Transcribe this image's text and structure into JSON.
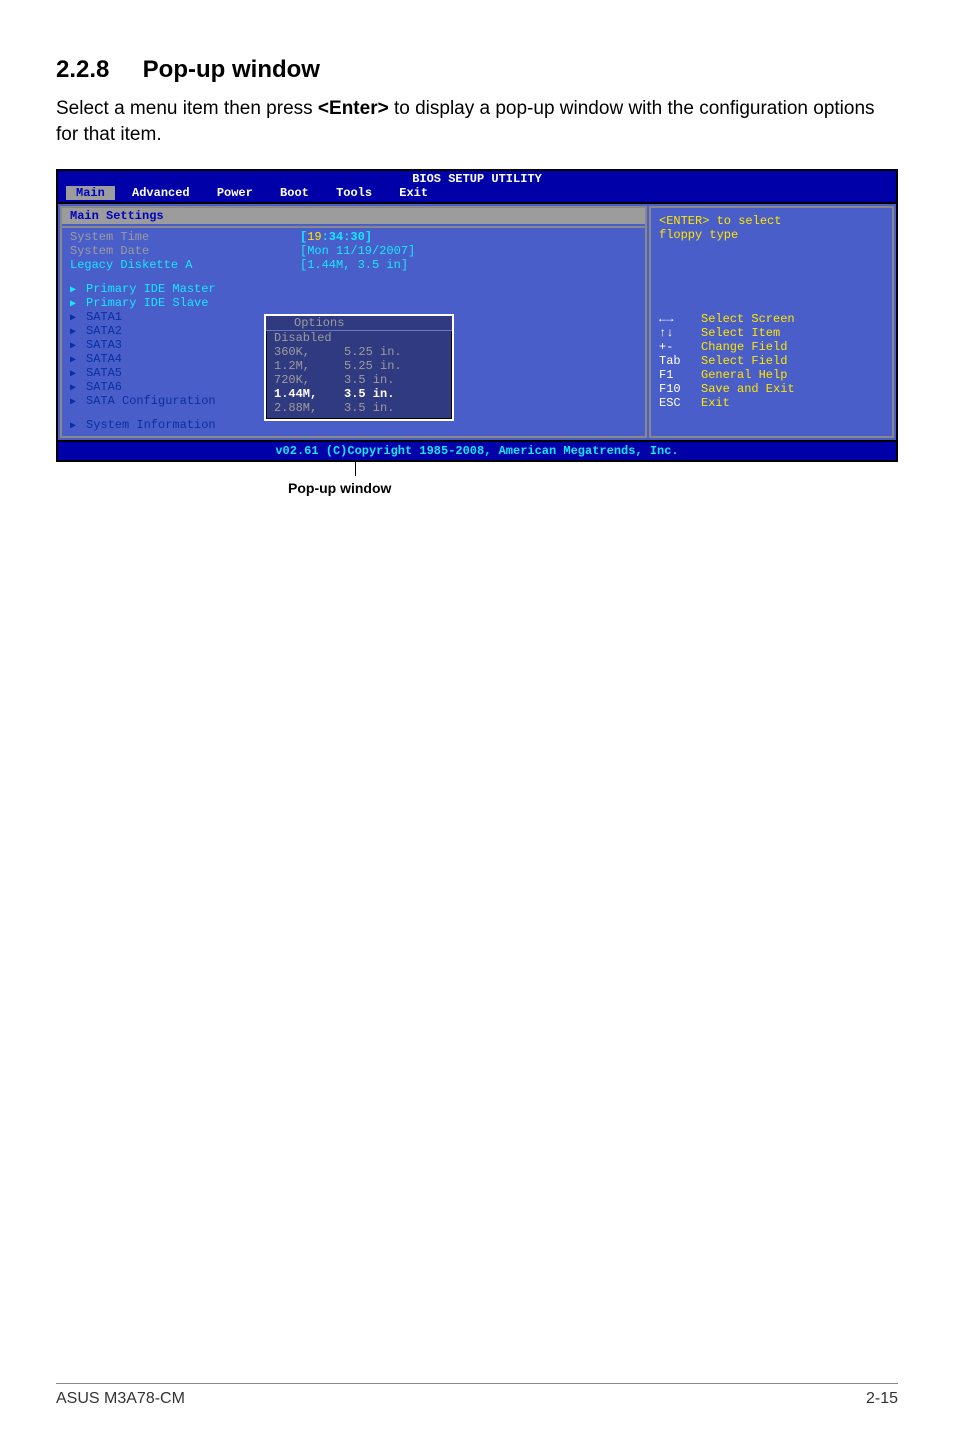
{
  "heading_num": "2.2.8",
  "heading_text": "Pop-up window",
  "intro_pre": "Select a menu item then press ",
  "intro_bold": "<Enter>",
  "intro_post": " to display a pop-up window with the configuration options for that item.",
  "bios": {
    "title": "BIOS SETUP UTILITY",
    "menu": {
      "items": [
        {
          "label": "Main",
          "active": true
        },
        {
          "label": "Advanced"
        },
        {
          "label": "Power"
        },
        {
          "label": "Boot"
        },
        {
          "label": "Tools"
        },
        {
          "label": "Exit"
        }
      ]
    },
    "section": "Main Settings",
    "st_label": "System Time",
    "st_val_pre": "[",
    "st_val_hi": "19",
    "st_val_post": ":34:30]",
    "sd_label": "System Date",
    "sd_val": "[Mon 11/19/2007]",
    "ld_label": "Legacy Diskette A",
    "ld_val": "[1.44M, 3.5 in]",
    "rows": [
      {
        "label": "Primary IDE Master",
        "val": "",
        "dim": false
      },
      {
        "label": "Primary IDE Slave",
        "val": "",
        "dim": false
      },
      {
        "label": "SATA1",
        "dim": true
      },
      {
        "label": "SATA2",
        "dim": true
      },
      {
        "label": "SATA3",
        "dim": true
      },
      {
        "label": "SATA4",
        "dim": true
      },
      {
        "label": "SATA5",
        "dim": true
      },
      {
        "label": "SATA6",
        "dim": true
      },
      {
        "label": "SATA Configuration",
        "dim": true
      },
      {
        "label": "System Information",
        "dim": true
      }
    ],
    "help_line1": "<ENTER> to select",
    "help_line2": "floppy type",
    "legend": [
      {
        "k": "",
        "icon": "lr",
        "v": "Select Screen"
      },
      {
        "k": "",
        "icon": "ud",
        "v": "Select Item"
      },
      {
        "k": "+-",
        "v": "Change Field"
      },
      {
        "k": "Tab",
        "v": "Select Field"
      },
      {
        "k": "F1",
        "v": "General Help"
      },
      {
        "k": "F10",
        "v": "Save and Exit"
      },
      {
        "k": "ESC",
        "v": "Exit"
      }
    ],
    "footer": "v02.61 (C)Copyright 1985-2008, American Megatrends, Inc.",
    "popup": {
      "title": "Options",
      "opts": [
        {
          "val": "Disabled",
          "size": ""
        },
        {
          "val": "360K,",
          "size": "5.25 in."
        },
        {
          "val": "1.2M,",
          "size": "5.25 in."
        },
        {
          "val": "720K,",
          "size": "3.5 in."
        },
        {
          "val": "1.44M,",
          "size": "3.5 in.",
          "sel": true
        },
        {
          "val": "2.88M,",
          "size": "3.5 in."
        }
      ]
    }
  },
  "caption": "Pop-up window",
  "page_footer_left": "ASUS M3A78-CM",
  "page_footer_right": "2-15"
}
